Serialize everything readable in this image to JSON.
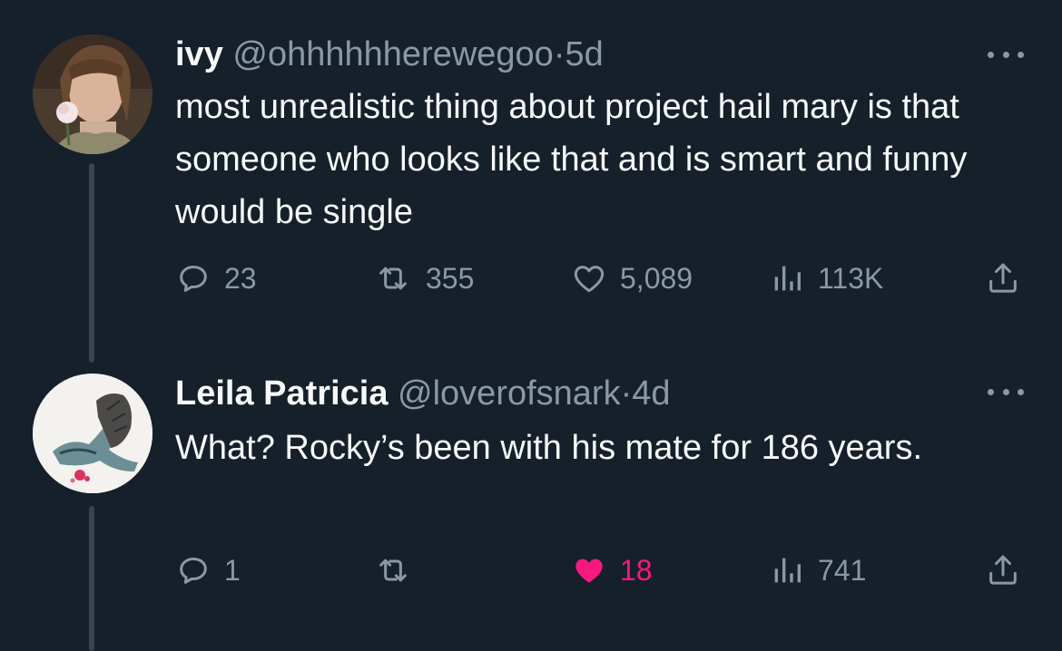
{
  "colors": {
    "background": "#15202b",
    "primary_text": "#f7f9f9",
    "secondary_text": "#8b98a5",
    "liked": "#f91880",
    "thread_line": "#38444d"
  },
  "tweets": [
    {
      "display_name": "ivy",
      "handle": "@ohhhhhherewegoo",
      "separator": "·",
      "time": "5d",
      "text": "most unrealistic thing about project hail mary is that someone who looks like that and is smart and funny would be single",
      "actions": {
        "replies": "23",
        "retweets": "355",
        "likes": "5,089",
        "views": "113K",
        "liked": false
      },
      "icons": [
        "avatar",
        "more-icon",
        "reply-icon",
        "retweet-icon",
        "like-icon",
        "views-icon",
        "share-icon"
      ]
    },
    {
      "display_name": "Leila Patricia",
      "handle": "@loverofsnark",
      "separator": "·",
      "time": "4d",
      "text": "What? Rocky’s been with his mate for 186 years.",
      "actions": {
        "replies": "1",
        "retweets": "",
        "likes": "18",
        "views": "741",
        "liked": true
      },
      "icons": [
        "avatar",
        "more-icon",
        "reply-icon",
        "retweet-icon",
        "like-icon-filled",
        "views-icon",
        "share-icon"
      ]
    }
  ]
}
